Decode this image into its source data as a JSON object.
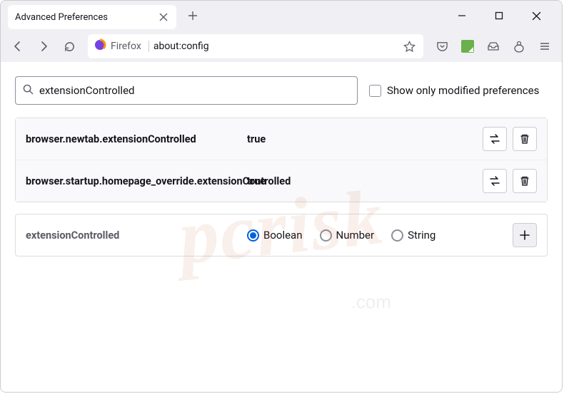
{
  "tab": {
    "title": "Advanced Preferences"
  },
  "url": {
    "prefix": "Firefox",
    "path": "about:config"
  },
  "search": {
    "value": "extensionControlled",
    "checkbox_label": "Show only modified preferences"
  },
  "prefs": [
    {
      "name": "browser.newtab.extensionControlled",
      "value": "true"
    },
    {
      "name": "browser.startup.homepage_override.extensionControlled",
      "value": "true"
    }
  ],
  "new_pref": {
    "name": "extensionControlled",
    "types": [
      "Boolean",
      "Number",
      "String"
    ],
    "selected": "Boolean"
  },
  "watermark": {
    "main": "pcrisk",
    "sub": ".com"
  }
}
